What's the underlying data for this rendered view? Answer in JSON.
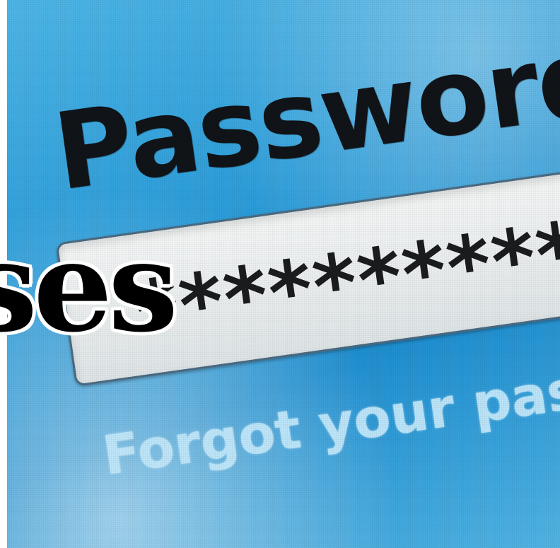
{
  "login_form": {
    "field_label": "Password",
    "password_masked": "************",
    "forgot_link": "Forgot your password?"
  },
  "overlay": {
    "headline_fragment": "ses"
  },
  "colors": {
    "screen_blue": "#2f9fdb",
    "field_background": "#e8eced",
    "label_text": "#101418",
    "link_text": "#bee6fa",
    "overlay_text": "#000000"
  }
}
